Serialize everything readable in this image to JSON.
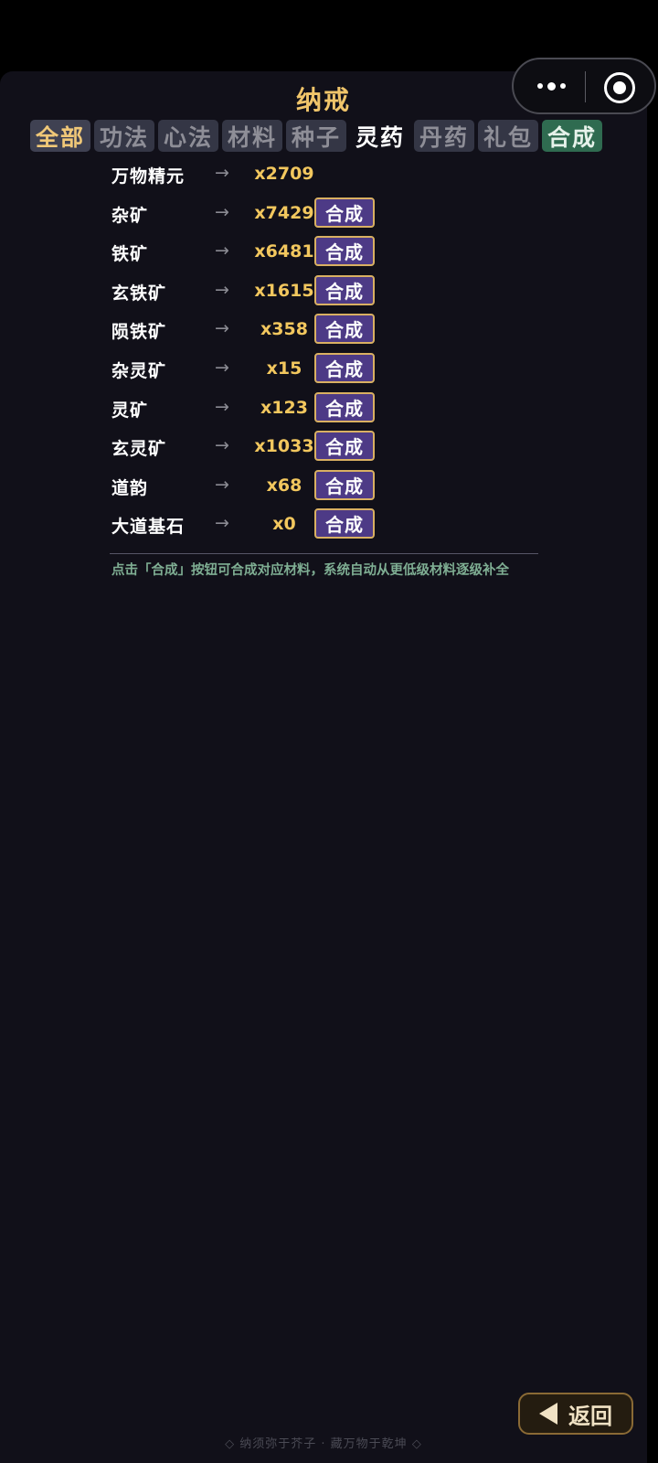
{
  "header": {
    "title": "纳戒"
  },
  "tabs": [
    {
      "label": "全部"
    },
    {
      "label": "功法"
    },
    {
      "label": "心法"
    },
    {
      "label": "材料"
    },
    {
      "label": "种子"
    },
    {
      "label": "灵药"
    },
    {
      "label": "丹药"
    },
    {
      "label": "礼包"
    },
    {
      "label": "合成"
    }
  ],
  "arrow_glyph": "→",
  "synth_button_label": "合成",
  "items": [
    {
      "name": "万物精元",
      "qty": "x2709"
    },
    {
      "name": "杂矿",
      "qty": "x7429"
    },
    {
      "name": "铁矿",
      "qty": "x6481"
    },
    {
      "name": "玄铁矿",
      "qty": "x1615"
    },
    {
      "name": "陨铁矿",
      "qty": "x358"
    },
    {
      "name": "杂灵矿",
      "qty": "x15"
    },
    {
      "name": "灵矿",
      "qty": "x123"
    },
    {
      "name": "玄灵矿",
      "qty": "x1033"
    },
    {
      "name": "道韵",
      "qty": "x68"
    },
    {
      "name": "大道基石",
      "qty": "x0"
    }
  ],
  "hint": "点击「合成」按钮可合成对应材料，系统自动从更低级材料逐级补全",
  "back_label": "返回",
  "footer": "◇ 纳须弥于芥子 · 藏万物于乾坤 ◇",
  "colors": {
    "accent_gold": "#f0c56a",
    "button_purple": "#4d3a86",
    "tab_synth_green": "#2f6b50",
    "hint_green": "#7fae93"
  }
}
